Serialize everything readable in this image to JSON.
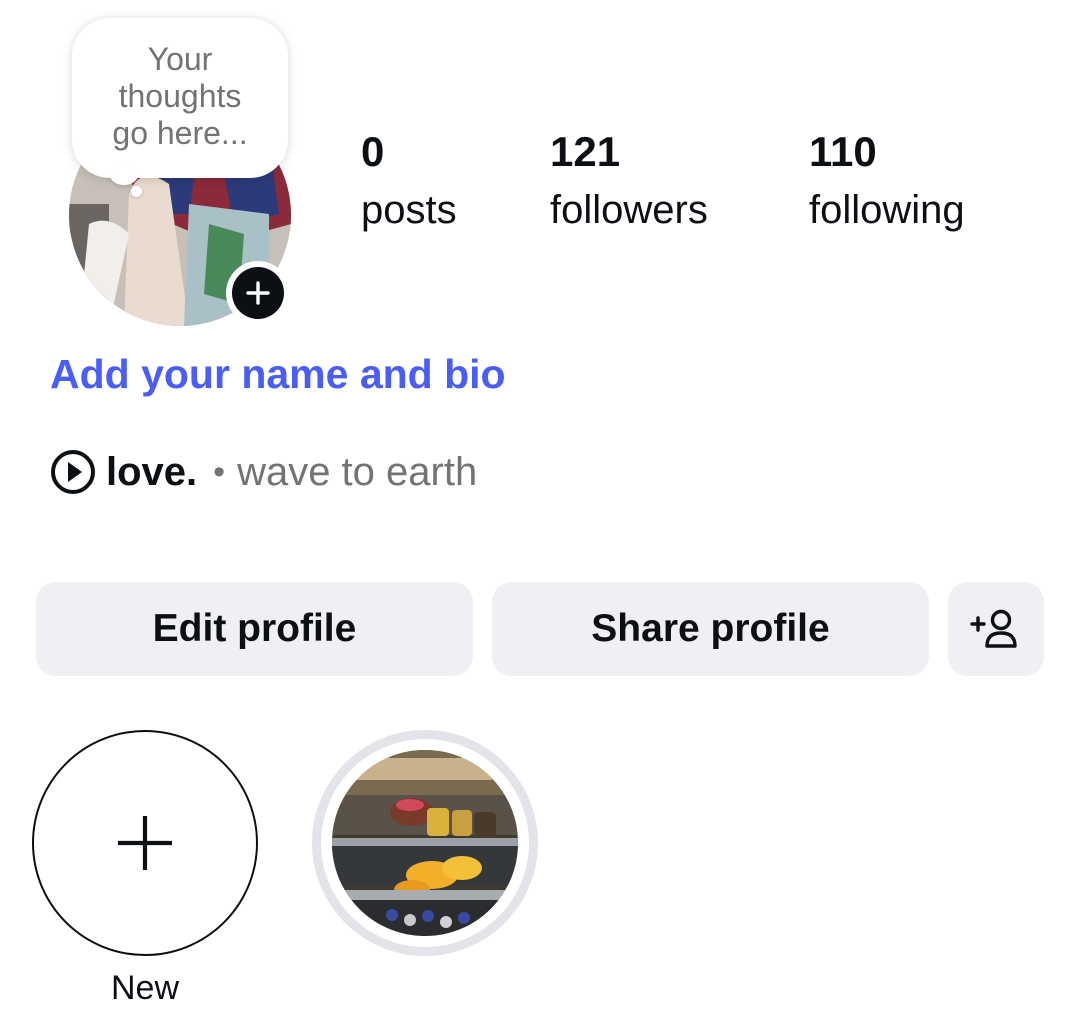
{
  "profile": {
    "note_placeholder": "Your\nthoughts\ngo here...",
    "avatar_add_icon": "plus-icon",
    "add_bio_label": "Add your name and bio"
  },
  "stats": [
    {
      "count": "0",
      "label": "posts"
    },
    {
      "count": "121",
      "label": "followers"
    },
    {
      "count": "110",
      "label": "following"
    }
  ],
  "music": {
    "icon": "play-circle-icon",
    "song": "love.",
    "separator": "•",
    "artist": "wave to earth"
  },
  "actions": {
    "edit_label": "Edit profile",
    "share_label": "Share profile",
    "suggest_icon": "add-person-icon"
  },
  "highlights": {
    "new_label": "New",
    "new_icon": "plus-icon",
    "items": [
      {
        "label": ""
      }
    ]
  },
  "colors": {
    "accent_link": "#4a5df9",
    "button_bg": "#efeff4",
    "secondary_text": "#737373",
    "primary_text": "#0c1014"
  }
}
